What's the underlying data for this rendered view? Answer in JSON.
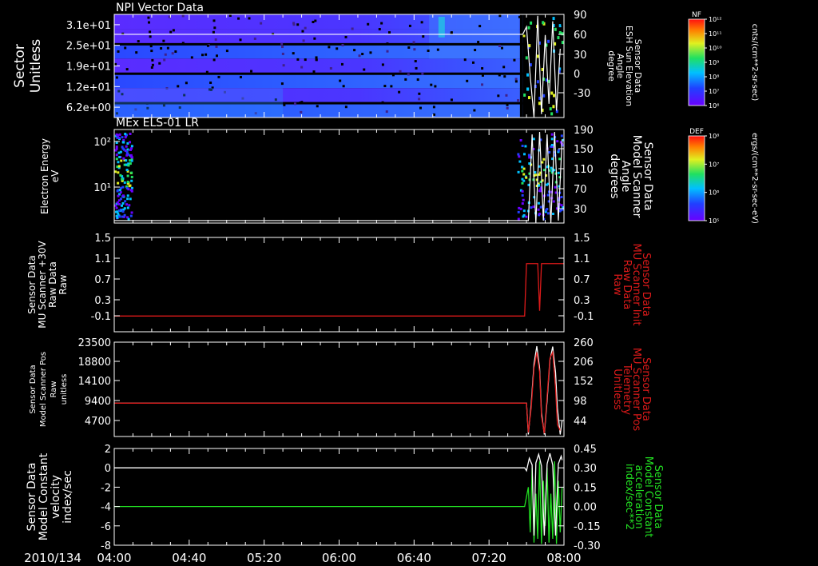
{
  "chart_data": [
    {
      "type": "heatmap",
      "title": "NPI Vector Data",
      "ylabel_lines": [
        "Sector",
        "Unitless"
      ],
      "yticks": [
        "3.1e+01",
        "2.5e+01",
        "1.9e+01",
        "1.2e+01",
        "6.2e+00"
      ],
      "y2label_lines": [
        "Sensor Data",
        "ESH Sun Elevation",
        "Angle",
        "degree"
      ],
      "y2ticks": [
        "90",
        "60",
        "30",
        "0",
        "-30"
      ],
      "y2lim": [
        -60,
        90
      ],
      "colorbar": {
        "title": "NF",
        "labels": [
          "10¹²",
          "10¹¹",
          "10¹⁰",
          "10⁹",
          "10⁸",
          "10⁷",
          "10⁶"
        ],
        "unit": "cnts/(cm**2-sr-sec)"
      }
    },
    {
      "type": "heatmap",
      "title": "MEx ELS-01 LR",
      "ylabel_lines": [
        "Electron Energy",
        "eV"
      ],
      "yticks": [
        "10²",
        "10¹"
      ],
      "y2label_lines": [
        "Sensor Data",
        "Model Scanner",
        "Angle",
        "degrees"
      ],
      "y2ticks": [
        "190",
        "150",
        "110",
        "70",
        "30"
      ],
      "y2lim": [
        0,
        190
      ],
      "colorbar": {
        "title": "DEF",
        "labels": [
          "10⁸",
          "10⁷",
          "10⁶",
          "10⁵"
        ],
        "unit": "ergs/(cm**2-sr-sec-eV)"
      }
    },
    {
      "type": "line",
      "ylabel_lines": [
        "Sensor Data",
        "MU Scanner +30V",
        "Raw Data",
        "Raw"
      ],
      "yticks": [
        "1.5",
        "1.1",
        "0.7",
        "0.3",
        "-0.1"
      ],
      "ylim": [
        -0.3,
        1.5
      ],
      "y2label_lines": [
        "Sensor Data",
        "MU Scanner Init",
        "Raw Data",
        "Raw"
      ],
      "y2ticks": [
        "1.5",
        "1.1",
        "0.7",
        "0.3",
        "-0.1"
      ],
      "y2lim": [
        -0.3,
        1.5
      ],
      "series": [
        {
          "x": [
            240,
            459,
            460,
            462,
            466,
            467,
            468,
            469,
            470,
            474,
            475,
            480
          ],
          "y": [
            0,
            0,
            1,
            1,
            1,
            0.1,
            1,
            1,
            1,
            1,
            1,
            1
          ]
        }
      ]
    },
    {
      "type": "line",
      "ylabel_lines": [
        "Sensor Data",
        "Model Scanner Pos",
        "Raw",
        "unitless"
      ],
      "yticks": [
        "23500",
        "18800",
        "14100",
        "9400",
        "4700"
      ],
      "ylim": [
        0,
        23500
      ],
      "y2label_lines": [
        "Sensor Data",
        "MU Scanner Pos",
        "Telemetry",
        "Unitless"
      ],
      "y2ticks": [
        "260",
        "206",
        "152",
        "98",
        "44"
      ],
      "y2lim": [
        0,
        260
      ],
      "series": [
        {
          "x": [
            240,
            460,
            461,
            462.5,
            464,
            465.5,
            467,
            468,
            469.5,
            471,
            472.5,
            474,
            475.5,
            476.5,
            478,
            479
          ],
          "y": [
            8300,
            8300,
            500,
            8000,
            18000,
            22500,
            17000,
            6000,
            500,
            9000,
            19000,
            22400,
            16000,
            7000,
            500,
            4000
          ]
        },
        {
          "x": [
            240,
            460,
            461,
            462.5,
            464,
            465.5,
            467,
            468,
            469.5,
            471,
            472.5,
            474,
            475.5,
            476.5,
            478
          ],
          "y": [
            8300,
            8300,
            1000,
            7000,
            17000,
            21000,
            16000,
            5000,
            800,
            10000,
            19500,
            21000,
            12000,
            3000,
            1500
          ]
        }
      ]
    },
    {
      "type": "line",
      "ylabel_lines": [
        "Sensor Data",
        "Model Constant",
        "velocity",
        "index/sec"
      ],
      "yticks": [
        "2",
        "0",
        "-2",
        "-4",
        "-6",
        "-8"
      ],
      "ylim": [
        -8,
        2
      ],
      "y2label_lines": [
        "Sensor Data",
        "Model Constant",
        "acceleration",
        "index/sec**2"
      ],
      "y2ticks": [
        "0.45",
        "0.30",
        "0.15",
        "0.00",
        "-0.15",
        "-0.30"
      ],
      "y2lim": [
        -0.3,
        0.45
      ],
      "series": [
        {
          "x": [
            240,
            459,
            460,
            461.5,
            463,
            464,
            465,
            466.5,
            468,
            469.5,
            471,
            472.5,
            474,
            475.5,
            477,
            478.5,
            479
          ],
          "y": [
            0,
            0,
            -0.3,
            1,
            0.3,
            -7,
            0.5,
            1.4,
            0.2,
            -7,
            0.4,
            1.5,
            0.3,
            -7,
            0.4,
            1.2,
            0.8
          ]
        },
        {
          "x": [
            240,
            459,
            461,
            462,
            463,
            464,
            465,
            466,
            467,
            468,
            469,
            470,
            471,
            472,
            473,
            474,
            475,
            476,
            477,
            478,
            479
          ],
          "y": [
            0,
            0,
            0.15,
            -0.2,
            0.3,
            -0.28,
            0.1,
            -0.25,
            0.35,
            -0.29,
            0.2,
            -0.15,
            0.3,
            -0.28,
            0.1,
            -0.25,
            0.35,
            -0.29,
            0.2,
            -0.2,
            0.15
          ]
        }
      ]
    }
  ],
  "time_axis": {
    "date_label": "2010/134",
    "ticks": [
      "04:00",
      "04:40",
      "05:20",
      "06:00",
      "06:40",
      "07:20",
      "08:00"
    ],
    "xlim": [
      240,
      480
    ]
  },
  "colors": {
    "background": "#000000",
    "axes": "#ffffff",
    "line_red": "#dd1a1a",
    "line_green": "#22e022",
    "line_white": "#ffffff"
  }
}
